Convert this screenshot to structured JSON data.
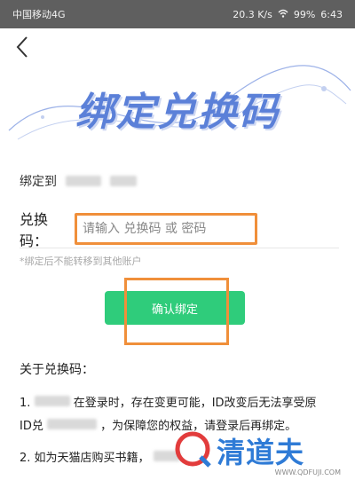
{
  "status_bar": {
    "carrier": "中国移动4G",
    "speed": "20.3 K/s",
    "battery": "99%",
    "time": "6:43"
  },
  "page": {
    "title": "绑定兑换码",
    "bound_prefix": "绑定到"
  },
  "form": {
    "code_label": "兑换码：",
    "code_placeholder": "请输入 兑换码 或 密码",
    "note": "*绑定后不能转移到其他账户",
    "confirm_label": "确认绑定"
  },
  "about": {
    "title": "关于兑换码：",
    "item1_prefix": "1.",
    "item1_text": "在登录时，存在变更可能，ID改变后无法享受原",
    "item1_line2_prefix": "ID兑",
    "item1_line2_suffix": "，为保障您的权益，请登录后再绑定。",
    "item2_text": "2. 如为天猫店购买书籍，"
  },
  "watermark": {
    "text": "清道夫",
    "url": "WWW.QDFUJI.COM"
  },
  "colors": {
    "accent_blue": "#5b80d8",
    "confirm_green": "#2fcc7b",
    "highlight_orange": "#f08f3a"
  }
}
